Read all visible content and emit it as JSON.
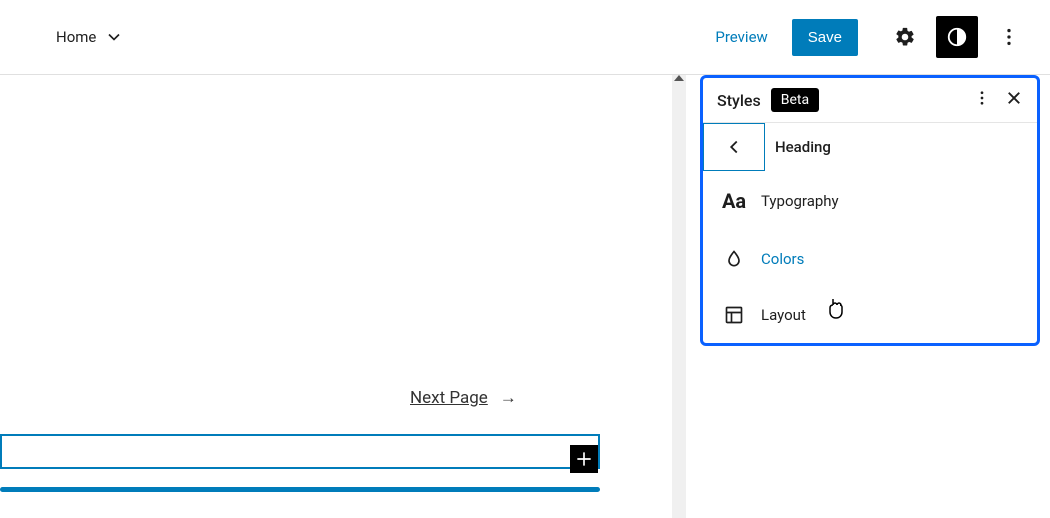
{
  "topbar": {
    "home_label": "Home",
    "preview_label": "Preview",
    "save_label": "Save"
  },
  "canvas": {
    "next_page_label": "Next Page",
    "arrow_glyph": "→"
  },
  "panel": {
    "title": "Styles",
    "badge": "Beta",
    "heading_label": "Heading",
    "items": [
      {
        "label": "Typography",
        "icon": "Aa"
      },
      {
        "label": "Colors"
      },
      {
        "label": "Layout"
      }
    ]
  }
}
